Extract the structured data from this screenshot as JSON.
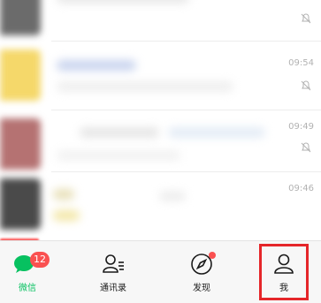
{
  "chat_list": {
    "rows": [
      {
        "time": "",
        "muted": true
      },
      {
        "time": "09:54",
        "muted": true
      },
      {
        "time": "09:49",
        "muted": true
      },
      {
        "time": "09:46",
        "muted": false
      }
    ]
  },
  "tabbar": {
    "tabs": [
      {
        "label": "微信",
        "icon": "chat-bubble-icon",
        "badge": "12",
        "active": true
      },
      {
        "label": "通讯录",
        "icon": "contacts-icon",
        "active": false
      },
      {
        "label": "发现",
        "icon": "compass-icon",
        "active": false,
        "dot": true
      },
      {
        "label": "我",
        "icon": "person-icon",
        "active": false,
        "highlighted": true
      }
    ]
  },
  "colors": {
    "accent_green": "#07c160",
    "badge_red": "#fa5151",
    "highlight_red": "#e5262a",
    "time_gray": "#b2b2b2"
  }
}
